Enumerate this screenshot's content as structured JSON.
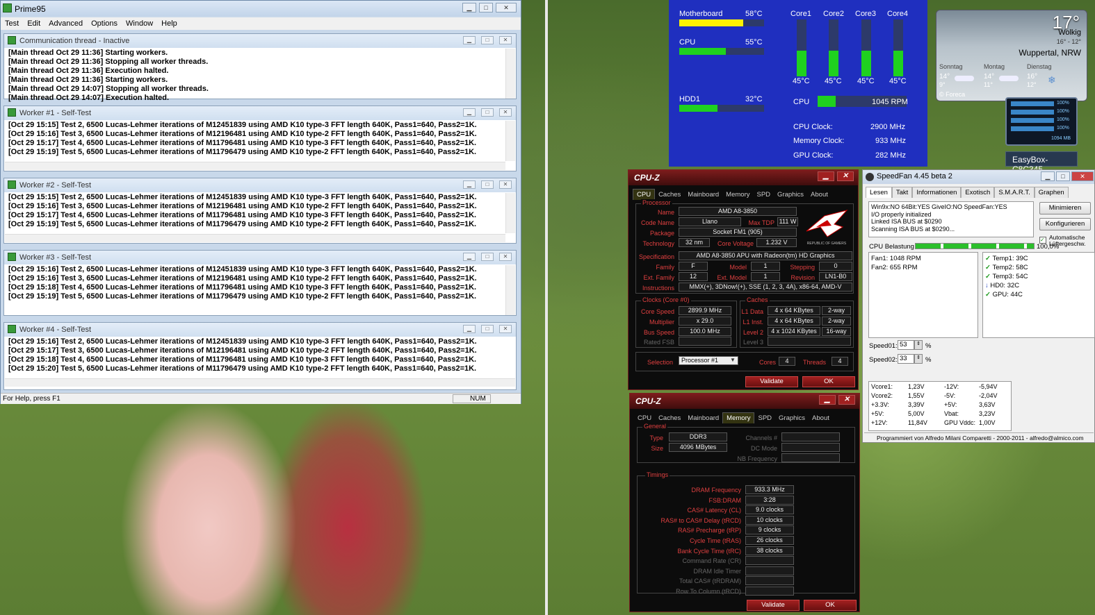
{
  "prime95": {
    "title": "Prime95",
    "menu": [
      "Test",
      "Edit",
      "Advanced",
      "Options",
      "Window",
      "Help"
    ],
    "comm": {
      "title": "Communication thread - Inactive",
      "lines": [
        "[Main thread Oct 29 11:36] Starting workers.",
        "[Main thread Oct 29 11:36] Stopping all worker threads.",
        "[Main thread Oct 29 11:36] Execution halted.",
        "[Main thread Oct 29 11:36] Starting workers.",
        "[Main thread Oct 29 14:07] Stopping all worker threads.",
        "[Main thread Oct 29 14:07] Execution halted."
      ]
    },
    "workers": [
      {
        "title": "Worker #1 - Self-Test",
        "lines": [
          "[Oct 29 15:15] Test 2, 6500 Lucas-Lehmer iterations of M12451839 using AMD K10 type-3 FFT length 640K, Pass1=640, Pass2=1K.",
          "[Oct 29 15:16] Test 3, 6500 Lucas-Lehmer iterations of M12196481 using AMD K10 type-2 FFT length 640K, Pass1=640, Pass2=1K.",
          "[Oct 29 15:17] Test 4, 6500 Lucas-Lehmer iterations of M11796481 using AMD K10 type-3 FFT length 640K, Pass1=640, Pass2=1K.",
          "[Oct 29 15:19] Test 5, 6500 Lucas-Lehmer iterations of M11796479 using AMD K10 type-2 FFT length 640K, Pass1=640, Pass2=1K."
        ]
      },
      {
        "title": "Worker #2 - Self-Test",
        "lines": [
          "[Oct 29 15:15] Test 2, 6500 Lucas-Lehmer iterations of M12451839 using AMD K10 type-3 FFT length 640K, Pass1=640, Pass2=1K.",
          "[Oct 29 15:16] Test 3, 6500 Lucas-Lehmer iterations of M12196481 using AMD K10 type-2 FFT length 640K, Pass1=640, Pass2=1K.",
          "[Oct 29 15:17] Test 4, 6500 Lucas-Lehmer iterations of M11796481 using AMD K10 type-3 FFT length 640K, Pass1=640, Pass2=1K.",
          "[Oct 29 15:19] Test 5, 6500 Lucas-Lehmer iterations of M11796479 using AMD K10 type-2 FFT length 640K, Pass1=640, Pass2=1K."
        ]
      },
      {
        "title": "Worker #3 - Self-Test",
        "lines": [
          "[Oct 29 15:16] Test 2, 6500 Lucas-Lehmer iterations of M12451839 using AMD K10 type-3 FFT length 640K, Pass1=640, Pass2=1K.",
          "[Oct 29 15:16] Test 3, 6500 Lucas-Lehmer iterations of M12196481 using AMD K10 type-2 FFT length 640K, Pass1=640, Pass2=1K.",
          "[Oct 29 15:18] Test 4, 6500 Lucas-Lehmer iterations of M11796481 using AMD K10 type-3 FFT length 640K, Pass1=640, Pass2=1K.",
          "[Oct 29 15:19] Test 5, 6500 Lucas-Lehmer iterations of M11796479 using AMD K10 type-2 FFT length 640K, Pass1=640, Pass2=1K."
        ]
      },
      {
        "title": "Worker #4 - Self-Test",
        "lines": [
          "[Oct 29 15:16] Test 2, 6500 Lucas-Lehmer iterations of M12451839 using AMD K10 type-3 FFT length 640K, Pass1=640, Pass2=1K.",
          "[Oct 29 15:17] Test 3, 6500 Lucas-Lehmer iterations of M12196481 using AMD K10 type-2 FFT length 640K, Pass1=640, Pass2=1K.",
          "[Oct 29 15:18] Test 4, 6500 Lucas-Lehmer iterations of M11796481 using AMD K10 type-3 FFT length 640K, Pass1=640, Pass2=1K.",
          "[Oct 29 15:20] Test 5, 6500 Lucas-Lehmer iterations of M11796479 using AMD K10 type-2 FFT length 640K, Pass1=640, Pass2=1K."
        ]
      }
    ],
    "status": "For Help, press F1",
    "num": "NUM"
  },
  "gadget": {
    "mb_label": "Motherboard",
    "mb_temp": "58°C",
    "mb_level": 0.75,
    "cpu_label": "CPU",
    "cpu_temp": "55°C",
    "cpu_level": 0.55,
    "hdd_label": "HDD1",
    "hdd_temp": "32°C",
    "hdd_level": 0.45,
    "cores": [
      {
        "name": "Core1",
        "temp": "45°C",
        "level": 0.45
      },
      {
        "name": "Core2",
        "temp": "45°C",
        "level": 0.45
      },
      {
        "name": "Core3",
        "temp": "45°C",
        "level": 0.45
      },
      {
        "name": "Core4",
        "temp": "45°C",
        "level": 0.45
      }
    ],
    "fan_label": "CPU",
    "fan_rpm": "1045 RPM",
    "fan_level": 0.2,
    "cpu_clock_label": "CPU Clock:",
    "cpu_clock": "2900 MHz",
    "mem_clock_label": "Memory Clock:",
    "mem_clock": "933 MHz",
    "gpu_clock_label": "GPU Clock:",
    "gpu_clock": "282 MHz"
  },
  "weather": {
    "temp": "17°",
    "cond": "Wolkig",
    "range": "16° - 12°",
    "city": "Wuppertal, NRW",
    "days": [
      {
        "name": "Sonntag",
        "hi": "14°",
        "lo": "9°"
      },
      {
        "name": "Montag",
        "hi": "14°",
        "lo": "11°"
      },
      {
        "name": "Dienstag",
        "hi": "16°",
        "lo": "12°"
      }
    ],
    "source": "© Foreca"
  },
  "net": {
    "bars": [
      "100%",
      "100%",
      "100%",
      "100%"
    ],
    "mb": "1094 MB"
  },
  "easybox": "EasyBox-C8C345",
  "cpuz1": {
    "title": "CPU-Z",
    "tabs": [
      "CPU",
      "Caches",
      "Mainboard",
      "Memory",
      "SPD",
      "Graphics",
      "About"
    ],
    "processor_label": "Processor",
    "name_l": "Name",
    "name": "AMD A8-3850",
    "code_l": "Code Name",
    "code": "Llano",
    "tdp_l": "Max TDP",
    "tdp": "111 W",
    "pkg_l": "Package",
    "pkg": "Socket FM1 (905)",
    "tech_l": "Technology",
    "tech": "32 nm",
    "volt_l": "Core Voltage",
    "volt": "1.232 V",
    "spec_l": "Specification",
    "spec": "AMD A8-3850 APU with Radeon(tm) HD Graphics",
    "fam_l": "Family",
    "fam": "F",
    "model_l": "Model",
    "model": "1",
    "step_l": "Stepping",
    "step": "0",
    "extfam_l": "Ext. Family",
    "extfam": "12",
    "extmod_l": "Ext. Model",
    "extmod": "1",
    "rev_l": "Revision",
    "rev": "LN1-B0",
    "instr_l": "Instructions",
    "instr": "MMX(+), 3DNow!(+), SSE (1, 2, 3, 4A), x86-64, AMD-V",
    "rog": "REPUBLIC OF GAMERS",
    "clocks_label": "Clocks (Core #0)",
    "cs_l": "Core Speed",
    "cs": "2899.9 MHz",
    "mul_l": "Multiplier",
    "mul": "x 29.0",
    "bus_l": "Bus Speed",
    "bus": "100.0 MHz",
    "fsb_l": "Rated FSB",
    "caches_label": "Caches",
    "l1d_l": "L1 Data",
    "l1d": "4 x 64 KBytes",
    "l1d_w": "2-way",
    "l1i_l": "L1 Inst.",
    "l1i": "4 x 64 KBytes",
    "l1i_w": "2-way",
    "l2_l": "Level 2",
    "l2": "4 x 1024 KBytes",
    "l2_w": "16-way",
    "l3_l": "Level 3",
    "sel_l": "Selection",
    "sel": "Processor #1",
    "cores_l": "Cores",
    "cores": "4",
    "threads_l": "Threads",
    "threads": "4",
    "validate": "Validate",
    "ok": "OK"
  },
  "cpuz2": {
    "title": "CPU-Z",
    "tabs": [
      "CPU",
      "Caches",
      "Mainboard",
      "Memory",
      "SPD",
      "Graphics",
      "About"
    ],
    "general_label": "General",
    "type_l": "Type",
    "type": "DDR3",
    "size_l": "Size",
    "size": "4096 MBytes",
    "chan_l": "Channels #",
    "dc_l": "DC Mode",
    "nb_l": "NB Frequency",
    "timings_label": "Timings",
    "timings": [
      {
        "l": "DRAM Frequency",
        "v": "933.3 MHz"
      },
      {
        "l": "FSB:DRAM",
        "v": "3:28"
      },
      {
        "l": "CAS# Latency (CL)",
        "v": "9.0 clocks"
      },
      {
        "l": "RAS# to CAS# Delay (tRCD)",
        "v": "10 clocks"
      },
      {
        "l": "RAS# Precharge (tRP)",
        "v": "9 clocks"
      },
      {
        "l": "Cycle Time (tRAS)",
        "v": "26 clocks"
      },
      {
        "l": "Bank Cycle Time (tRC)",
        "v": "38 clocks"
      },
      {
        "l": "Command Rate (CR)",
        "v": ""
      },
      {
        "l": "DRAM Idle Timer",
        "v": ""
      },
      {
        "l": "Total CAS# (tRDRAM)",
        "v": ""
      },
      {
        "l": "Row To Column (tRCD)",
        "v": ""
      }
    ],
    "validate": "Validate",
    "ok": "OK"
  },
  "speedfan": {
    "title": "SpeedFan 4.45 beta 2",
    "tabs": [
      "Lesen",
      "Takt",
      "Informationen",
      "Exotisch",
      "S.M.A.R.T.",
      "Graphen"
    ],
    "log": [
      "Win9x:NO  64Bit:YES  GiveIO:NO  SpeedFan:YES",
      "I/O properly initialized",
      "Linked ISA BUS at $0290",
      "Scanning ISA BUS at $0290..."
    ],
    "btn_min": "Minimieren",
    "btn_cfg": "Konfigurieren",
    "auto_label": "Automatische Lüftergeschw.",
    "load_label": "CPU Belastung",
    "load": "100,0%",
    "load_level": 1.0,
    "fans": [
      "Fan1: 1048 RPM",
      "Fan2: 655 RPM"
    ],
    "temps": [
      {
        "name": "Temp1:",
        "val": "39C",
        "ok": true
      },
      {
        "name": "Temp2:",
        "val": "58C",
        "ok": true
      },
      {
        "name": "Temp3:",
        "val": "54C",
        "ok": true
      },
      {
        "name": "HD0:",
        "val": "32C",
        "ok": false
      },
      {
        "name": "GPU:",
        "val": "44C",
        "ok": true
      }
    ],
    "speed01_l": "Speed01:",
    "speed01": "53",
    "speed02_l": "Speed02:",
    "speed02": "33",
    "pct": "%",
    "volts_left": [
      {
        "n": "Vcore1:",
        "v": "1,23V"
      },
      {
        "n": "Vcore2:",
        "v": "1,55V"
      },
      {
        "n": "+3.3V:",
        "v": "3,39V"
      },
      {
        "n": "+5V:",
        "v": "5,00V"
      },
      {
        "n": "+12V:",
        "v": "11,84V"
      }
    ],
    "volts_right": [
      {
        "n": "-12V:",
        "v": "-5,94V"
      },
      {
        "n": "-5V:",
        "v": "-2,04V"
      },
      {
        "n": "+5V:",
        "v": "3,63V"
      },
      {
        "n": "Vbat:",
        "v": "3,23V"
      },
      {
        "n": "GPU Vddc:",
        "v": "1,00V"
      }
    ],
    "footer": "Programmiert von Alfredo Milani Comparetti - 2000-2011 - alfredo@almico.com"
  }
}
